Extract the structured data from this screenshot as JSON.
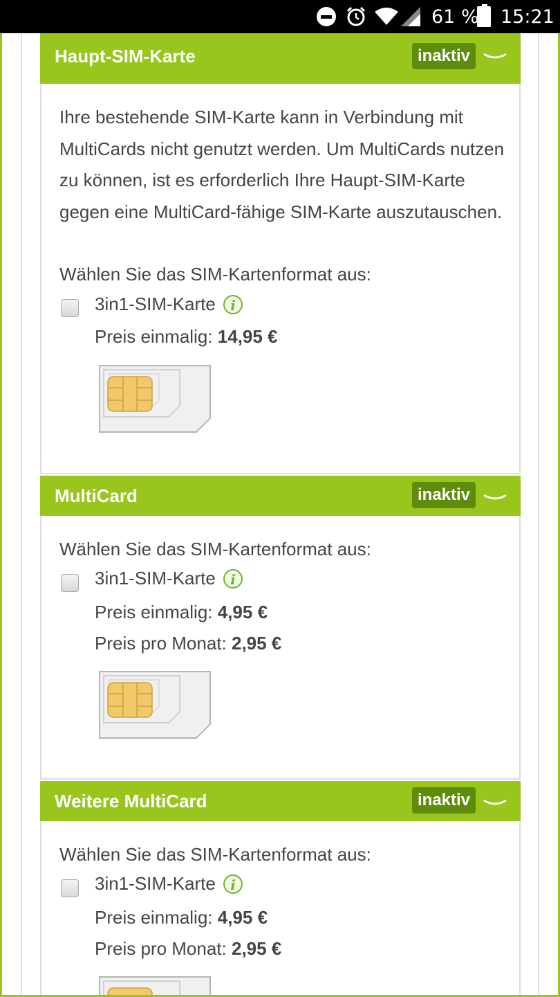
{
  "status_bar": {
    "battery_text": "61 %",
    "time": "15:21",
    "icons": [
      "do-not-disturb-icon",
      "alarm-icon",
      "wifi-icon",
      "signal-icon",
      "battery-icon"
    ]
  },
  "colors": {
    "accent": "#98c61c",
    "badge": "#5e8c0c",
    "text": "#444444"
  },
  "sections": [
    {
      "title": "Haupt-SIM-Karte",
      "status": "inaktiv",
      "description": "Ihre bestehende SIM-Karte kann in Verbindung mit MultiCards nicht genutzt werden. Um MultiCards nutzen zu können, ist es erforderlich Ihre Haupt-SIM-Karte gegen eine MultiCard-fähige SIM-Karte auszutauschen.",
      "prompt": "Wählen Sie das SIM-Kartenformat aus:",
      "option_label": "3in1-SIM-Karte",
      "price_once_label": "Preis einmalig:",
      "price_once_value": "14,95 €"
    },
    {
      "title": "MultiCard",
      "status": "inaktiv",
      "prompt": "Wählen Sie das SIM-Kartenformat aus:",
      "option_label": "3in1-SIM-Karte",
      "price_once_label": "Preis einmalig:",
      "price_once_value": "4,95 €",
      "price_month_label": "Preis pro Monat:",
      "price_month_value": "2,95 €"
    },
    {
      "title": "Weitere MultiCard",
      "status": "inaktiv",
      "prompt": "Wählen Sie das SIM-Kartenformat aus:",
      "option_label": "3in1-SIM-Karte",
      "price_once_label": "Preis einmalig:",
      "price_once_value": "4,95 €",
      "price_month_label": "Preis pro Monat:",
      "price_month_value": "2,95 €"
    }
  ]
}
